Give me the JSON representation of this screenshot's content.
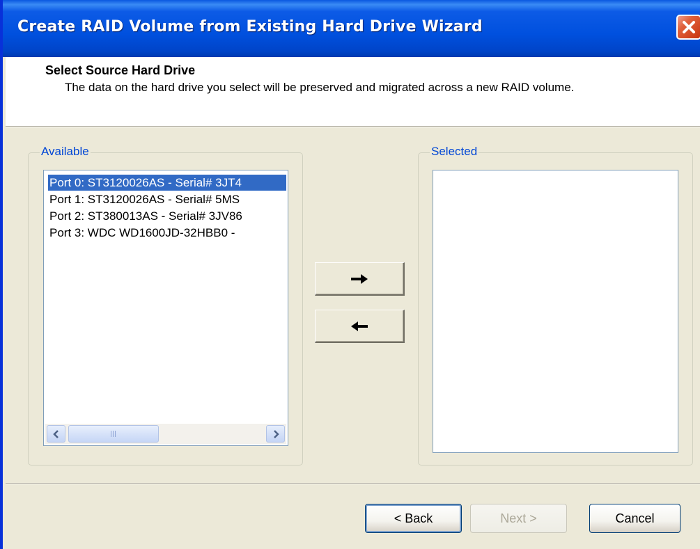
{
  "window": {
    "title": "Create RAID Volume from Existing Hard Drive Wizard"
  },
  "header": {
    "title": "Select Source Hard Drive",
    "description": "The data on the hard drive you select will be preserved and migrated across a new RAID volume."
  },
  "available": {
    "label": "Available",
    "items": [
      "Port 0: ST3120026AS - Serial# 3JT4",
      "Port 1: ST3120026AS - Serial# 5MS",
      "Port 2: ST380013AS - Serial# 3JV86",
      "Port 3: WDC WD1600JD-32HBB0 -"
    ],
    "selected_index": 0
  },
  "selected": {
    "label": "Selected",
    "items": []
  },
  "buttons": {
    "back": "< Back",
    "next": "Next >",
    "cancel": "Cancel"
  },
  "colors": {
    "titlebar": "#0054E3",
    "selection": "#316AC5",
    "group_label": "#0046D5",
    "dialog_bg": "#ECE9D8"
  },
  "icons": {
    "close": "close-icon",
    "add": "arrow-right-icon",
    "remove": "arrow-left-icon",
    "scroll_left": "scroll-left-icon",
    "scroll_right": "scroll-right-icon"
  }
}
